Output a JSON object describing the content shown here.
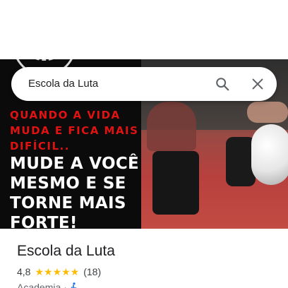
{
  "search": {
    "query": "Escola da Luta"
  },
  "hero": {
    "quote_red": "QUANDO A VIDA MUDA E FICA MAIS DIFÍCIL..",
    "quote_white": "MUDE A VOCÊ MESMO E SE TORNE MAIS FORTE!"
  },
  "place": {
    "name": "Escola da Luta",
    "rating": "4,8",
    "stars": "★★★★★",
    "reviews": "(18)",
    "category": "Academia",
    "separator": "·"
  },
  "colors": {
    "star": "#fbbc04",
    "quote_red": "#e01212",
    "accessibility_icon": "#1a73e8"
  },
  "icons": {
    "search": "search-icon",
    "close": "close-icon",
    "accessibility": "wheelchair-accessible-icon"
  }
}
